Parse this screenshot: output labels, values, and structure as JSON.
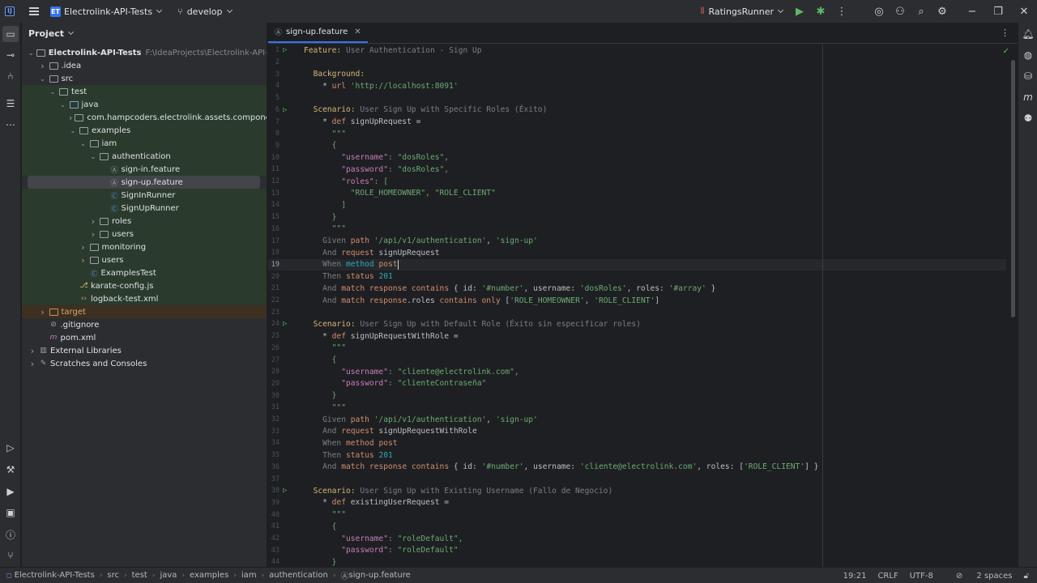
{
  "titlebar": {
    "project_badge": "ET",
    "project_name": "Electrolink-API-Tests",
    "branch": "develop",
    "run_config": "RatingsRunner"
  },
  "project_panel": {
    "title": "Project",
    "tree": [
      {
        "label": "Electrolink-API-Tests",
        "extra": "F:\\IdeaProjects\\Electrolink-API-Tests",
        "level": 0,
        "arrow": "open",
        "icon": "folder",
        "bold": true
      },
      {
        "label": ".idea",
        "level": 1,
        "arrow": "closed",
        "icon": "folder"
      },
      {
        "label": "src",
        "level": 1,
        "arrow": "open",
        "icon": "folder"
      },
      {
        "label": "test",
        "level": 2,
        "arrow": "open",
        "icon": "folder",
        "bg": "green"
      },
      {
        "label": "java",
        "level": 3,
        "arrow": "open",
        "icon": "java-folder",
        "bg": "green"
      },
      {
        "label": "com.hampcoders.electrolink.assets.component",
        "level": 4,
        "arrow": "closed",
        "icon": "package",
        "bg": "green"
      },
      {
        "label": "examples",
        "level": 4,
        "arrow": "open",
        "icon": "package",
        "bg": "green"
      },
      {
        "label": "iam",
        "level": 5,
        "arrow": "open",
        "icon": "package",
        "bg": "green"
      },
      {
        "label": "authentication",
        "level": 6,
        "arrow": "open",
        "icon": "package",
        "bg": "green"
      },
      {
        "label": "sign-in.feature",
        "level": 7,
        "arrow": "none",
        "icon": "feature",
        "bg": "green"
      },
      {
        "label": "sign-up.feature",
        "level": 7,
        "arrow": "none",
        "icon": "feature",
        "bg": "selected"
      },
      {
        "label": "SignInRunner",
        "level": 7,
        "arrow": "none",
        "icon": "runner",
        "bg": "green"
      },
      {
        "label": "SignUpRunner",
        "level": 7,
        "arrow": "none",
        "icon": "runner",
        "bg": "green"
      },
      {
        "label": "roles",
        "level": 6,
        "arrow": "closed",
        "icon": "package",
        "bg": "green"
      },
      {
        "label": "users",
        "level": 6,
        "arrow": "closed",
        "icon": "package",
        "bg": "green"
      },
      {
        "label": "monitoring",
        "level": 5,
        "arrow": "closed",
        "icon": "package",
        "bg": "green"
      },
      {
        "label": "users",
        "level": 5,
        "arrow": "closed",
        "icon": "package",
        "bg": "green"
      },
      {
        "label": "ExamplesTest",
        "level": 5,
        "arrow": "none",
        "icon": "runner",
        "bg": "green"
      },
      {
        "label": "karate-config.js",
        "level": 4,
        "arrow": "none",
        "icon": "js",
        "bg": "green"
      },
      {
        "label": "logback-test.xml",
        "level": 4,
        "arrow": "none",
        "icon": "xml",
        "bg": "green"
      },
      {
        "label": "target",
        "level": 1,
        "arrow": "closed",
        "icon": "target-folder",
        "bg": "orange"
      },
      {
        "label": ".gitignore",
        "level": 1,
        "arrow": "none",
        "icon": "gitignore"
      },
      {
        "label": "pom.xml",
        "level": 1,
        "arrow": "none",
        "icon": "maven"
      },
      {
        "label": "External Libraries",
        "level": 0,
        "arrow": "closed",
        "icon": "libraries"
      },
      {
        "label": "Scratches and Consoles",
        "level": 0,
        "arrow": "closed",
        "icon": "scratches"
      }
    ]
  },
  "editor": {
    "tab_label": "sign-up.feature",
    "current_line": 19,
    "lines": [
      {
        "n": "1",
        "run": true,
        "tokens": [
          [
            "fkw",
            "Feature:"
          ],
          [
            "com",
            " User Authentication - Sign Up"
          ]
        ]
      },
      {
        "n": "2",
        "tokens": []
      },
      {
        "n": "3",
        "tokens": [
          [
            "txt",
            "  "
          ],
          [
            "fkw",
            "Background:"
          ]
        ]
      },
      {
        "n": "4",
        "tokens": [
          [
            "txt",
            "    * "
          ],
          [
            "kw",
            "url"
          ],
          [
            "txt",
            " "
          ],
          [
            "str",
            "'http://localhost:8091'"
          ]
        ]
      },
      {
        "n": "5",
        "tokens": []
      },
      {
        "n": "6",
        "run": true,
        "tokens": [
          [
            "txt",
            "  "
          ],
          [
            "fkw",
            "Scenario:"
          ],
          [
            "com",
            " User Sign Up with Specific Roles (Éxito)"
          ]
        ]
      },
      {
        "n": "7",
        "tokens": [
          [
            "txt",
            "    * "
          ],
          [
            "kw",
            "def"
          ],
          [
            "txt",
            " signUpRequest ="
          ]
        ]
      },
      {
        "n": "8",
        "tokens": [
          [
            "str",
            "      \"\"\""
          ]
        ]
      },
      {
        "n": "9",
        "tokens": [
          [
            "str",
            "      {"
          ]
        ]
      },
      {
        "n": "10",
        "tokens": [
          [
            "str",
            "        "
          ],
          [
            "key",
            "\"username\""
          ],
          [
            "str",
            ": \"dosRoles\","
          ]
        ]
      },
      {
        "n": "11",
        "tokens": [
          [
            "str",
            "        "
          ],
          [
            "key",
            "\"password\""
          ],
          [
            "str",
            ": \"dosRoles\","
          ]
        ]
      },
      {
        "n": "12",
        "tokens": [
          [
            "str",
            "        "
          ],
          [
            "key",
            "\"roles\""
          ],
          [
            "str",
            ": ["
          ]
        ]
      },
      {
        "n": "13",
        "tokens": [
          [
            "str",
            "          \"ROLE_HOMEOWNER\", \"ROLE_CLIENT\""
          ]
        ]
      },
      {
        "n": "14",
        "tokens": [
          [
            "str",
            "        ]"
          ]
        ]
      },
      {
        "n": "15",
        "tokens": [
          [
            "str",
            "      }"
          ]
        ]
      },
      {
        "n": "16",
        "tokens": [
          [
            "str",
            "      \"\"\""
          ]
        ]
      },
      {
        "n": "17",
        "tokens": [
          [
            "com",
            "    Given"
          ],
          [
            "txt",
            " "
          ],
          [
            "kw",
            "path"
          ],
          [
            "txt",
            " "
          ],
          [
            "str",
            "'/api/v1/authentication'"
          ],
          [
            "txt",
            ", "
          ],
          [
            "str",
            "'sign-up'"
          ]
        ]
      },
      {
        "n": "18",
        "tokens": [
          [
            "com",
            "    And"
          ],
          [
            "txt",
            " "
          ],
          [
            "kw",
            "request"
          ],
          [
            "txt",
            " signUpRequest"
          ]
        ]
      },
      {
        "n": "19",
        "tokens": [
          [
            "com",
            "    When"
          ],
          [
            "txt",
            " "
          ],
          [
            "num",
            "method"
          ],
          [
            "txt",
            " "
          ],
          [
            "kw",
            "post"
          ]
        ],
        "caret": true
      },
      {
        "n": "20",
        "tokens": [
          [
            "com",
            "    Then"
          ],
          [
            "txt",
            " "
          ],
          [
            "kw",
            "status"
          ],
          [
            "txt",
            " "
          ],
          [
            "num",
            "201"
          ]
        ]
      },
      {
        "n": "21",
        "tokens": [
          [
            "com",
            "    And"
          ],
          [
            "txt",
            " "
          ],
          [
            "kw",
            "match"
          ],
          [
            "txt",
            " "
          ],
          [
            "kw",
            "response"
          ],
          [
            "txt",
            " "
          ],
          [
            "kw",
            "contains"
          ],
          [
            "txt",
            " { id: "
          ],
          [
            "str",
            "'#number'"
          ],
          [
            "txt",
            ", username: "
          ],
          [
            "str",
            "'dosRoles'"
          ],
          [
            "txt",
            ", roles: "
          ],
          [
            "str",
            "'#array'"
          ],
          [
            "txt",
            " }"
          ]
        ]
      },
      {
        "n": "22",
        "tokens": [
          [
            "com",
            "    And"
          ],
          [
            "txt",
            " "
          ],
          [
            "kw",
            "match"
          ],
          [
            "txt",
            " "
          ],
          [
            "kw",
            "response"
          ],
          [
            "txt",
            ".roles "
          ],
          [
            "kw",
            "contains only"
          ],
          [
            "txt",
            " ["
          ],
          [
            "str",
            "'ROLE_HOMEOWNER'"
          ],
          [
            "txt",
            ", "
          ],
          [
            "str",
            "'ROLE_CLIENT'"
          ],
          [
            "txt",
            "]"
          ]
        ]
      },
      {
        "n": "23",
        "tokens": []
      },
      {
        "n": "24",
        "run": true,
        "tokens": [
          [
            "txt",
            "  "
          ],
          [
            "fkw",
            "Scenario:"
          ],
          [
            "com",
            " User Sign Up with Default Role (Éxito sin especificar roles)"
          ]
        ]
      },
      {
        "n": "25",
        "tokens": [
          [
            "txt",
            "    * "
          ],
          [
            "kw",
            "def"
          ],
          [
            "txt",
            " signUpRequestWithRole ="
          ]
        ]
      },
      {
        "n": "26",
        "tokens": [
          [
            "str",
            "      \"\"\""
          ]
        ]
      },
      {
        "n": "27",
        "tokens": [
          [
            "str",
            "      {"
          ]
        ]
      },
      {
        "n": "28",
        "tokens": [
          [
            "str",
            "        "
          ],
          [
            "key",
            "\"username\""
          ],
          [
            "str",
            ": \"cliente@electrolink.com\","
          ]
        ]
      },
      {
        "n": "29",
        "tokens": [
          [
            "str",
            "        "
          ],
          [
            "key",
            "\"password\""
          ],
          [
            "str",
            ": \"clienteContraseña\""
          ]
        ]
      },
      {
        "n": "30",
        "tokens": [
          [
            "str",
            "      }"
          ]
        ]
      },
      {
        "n": "31",
        "tokens": [
          [
            "str",
            "      \"\"\""
          ]
        ]
      },
      {
        "n": "32",
        "tokens": [
          [
            "com",
            "    Given"
          ],
          [
            "txt",
            " "
          ],
          [
            "kw",
            "path"
          ],
          [
            "txt",
            " "
          ],
          [
            "str",
            "'/api/v1/authentication'"
          ],
          [
            "txt",
            ", "
          ],
          [
            "str",
            "'sign-up'"
          ]
        ]
      },
      {
        "n": "33",
        "tokens": [
          [
            "com",
            "    And"
          ],
          [
            "txt",
            " "
          ],
          [
            "kw",
            "request"
          ],
          [
            "txt",
            " signUpRequestWithRole"
          ]
        ]
      },
      {
        "n": "34",
        "tokens": [
          [
            "com",
            "    When"
          ],
          [
            "txt",
            " "
          ],
          [
            "kw",
            "method"
          ],
          [
            "txt",
            " "
          ],
          [
            "kw",
            "post"
          ]
        ]
      },
      {
        "n": "35",
        "tokens": [
          [
            "com",
            "    Then"
          ],
          [
            "txt",
            " "
          ],
          [
            "kw",
            "status"
          ],
          [
            "txt",
            " "
          ],
          [
            "num",
            "201"
          ]
        ]
      },
      {
        "n": "36",
        "tokens": [
          [
            "com",
            "    And"
          ],
          [
            "txt",
            " "
          ],
          [
            "kw",
            "match"
          ],
          [
            "txt",
            " "
          ],
          [
            "kw",
            "response"
          ],
          [
            "txt",
            " "
          ],
          [
            "kw",
            "contains"
          ],
          [
            "txt",
            " { id: "
          ],
          [
            "str",
            "'#number'"
          ],
          [
            "txt",
            ", username: "
          ],
          [
            "str",
            "'cliente@electrolink.com'"
          ],
          [
            "txt",
            ", roles: ["
          ],
          [
            "str",
            "'ROLE_CLIENT'"
          ],
          [
            "txt",
            "] }"
          ]
        ]
      },
      {
        "n": "37",
        "tokens": []
      },
      {
        "n": "38",
        "run": true,
        "tokens": [
          [
            "txt",
            "  "
          ],
          [
            "fkw",
            "Scenario:"
          ],
          [
            "com",
            " User Sign Up with Existing Username (Fallo de Negocio)"
          ]
        ]
      },
      {
        "n": "39",
        "tokens": [
          [
            "txt",
            "    * "
          ],
          [
            "kw",
            "def"
          ],
          [
            "txt",
            " existingUserRequest ="
          ]
        ]
      },
      {
        "n": "40",
        "tokens": [
          [
            "str",
            "      \"\"\""
          ]
        ]
      },
      {
        "n": "41",
        "tokens": [
          [
            "str",
            "      {"
          ]
        ]
      },
      {
        "n": "42",
        "tokens": [
          [
            "str",
            "        "
          ],
          [
            "key",
            "\"username\""
          ],
          [
            "str",
            ": \"roleDefault\","
          ]
        ]
      },
      {
        "n": "43",
        "tokens": [
          [
            "str",
            "        "
          ],
          [
            "key",
            "\"password\""
          ],
          [
            "str",
            ": \"roleDefault\""
          ]
        ]
      },
      {
        "n": "44",
        "tokens": [
          [
            "str",
            "      }"
          ]
        ]
      }
    ]
  },
  "statusbar": {
    "breadcrumbs": [
      "Electrolink-API-Tests",
      "src",
      "test",
      "java",
      "examples",
      "iam",
      "authentication",
      "sign-up.feature"
    ],
    "position": "19:21",
    "line_separator": "CRLF",
    "encoding": "UTF-8",
    "indent": "2 spaces"
  },
  "colors": {
    "accent": "#3574f0",
    "run_green": "#5fb865",
    "tree_green_bg": "#2a3a2c",
    "tree_orange_bg": "#3d3021"
  }
}
